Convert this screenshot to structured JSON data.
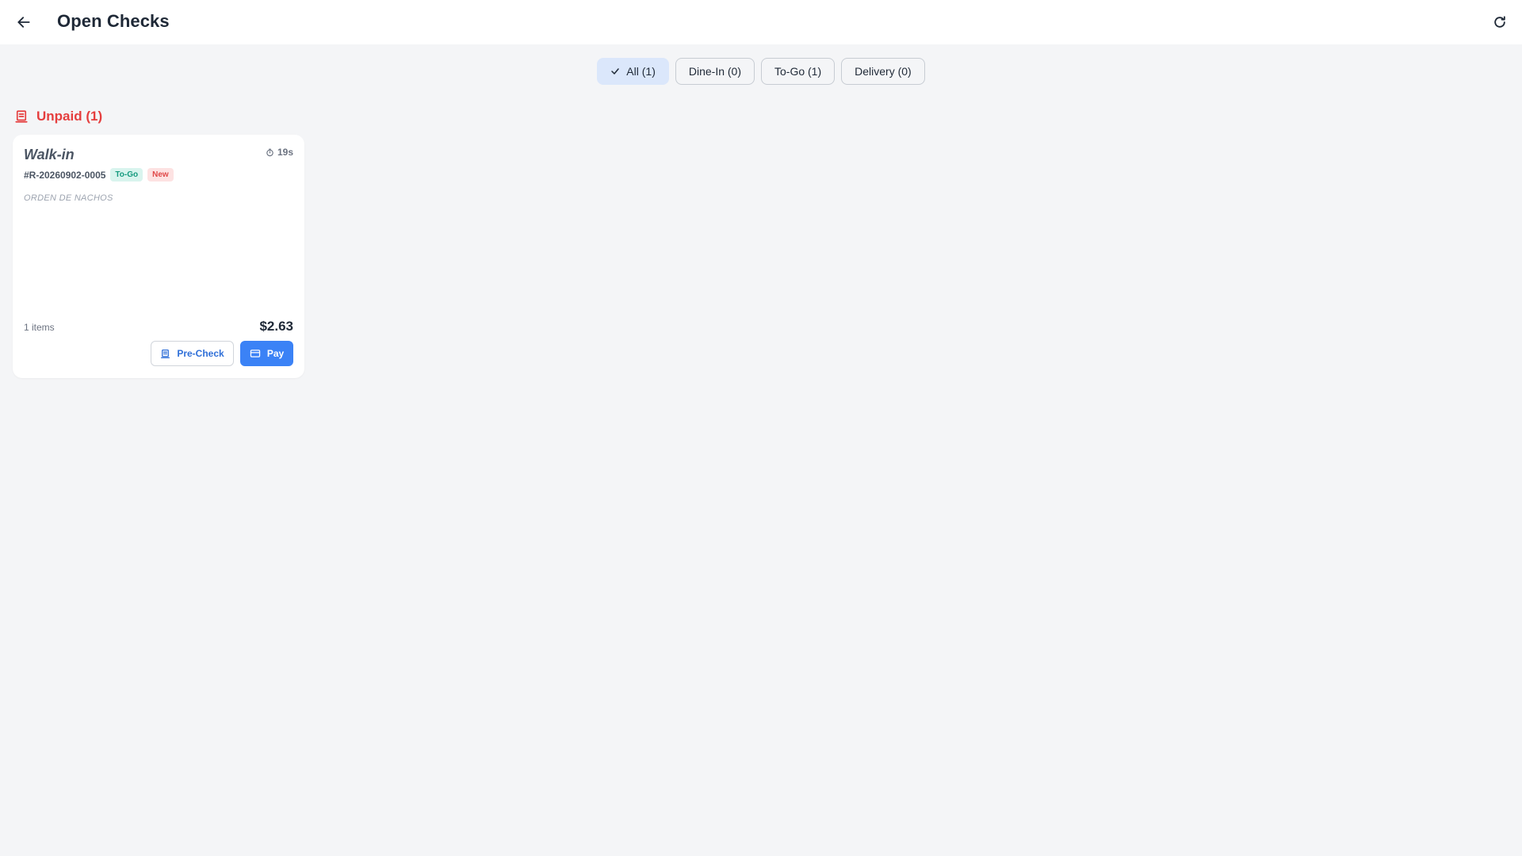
{
  "header": {
    "title": "Open Checks"
  },
  "filters": [
    {
      "label": "All (1)",
      "active": true
    },
    {
      "label": "Dine-In (0)",
      "active": false
    },
    {
      "label": "To-Go (1)",
      "active": false
    },
    {
      "label": "Delivery (0)",
      "active": false
    }
  ],
  "section": {
    "title": "Unpaid (1)",
    "color": "#e53e3e"
  },
  "check": {
    "customer": "Walk-in",
    "elapsed": "19s",
    "number": "#R-20260902-0005",
    "badges": {
      "order_type": "To-Go",
      "status": "New"
    },
    "item_line": "ORDEN DE NACHOS",
    "items_count": "1 items",
    "total": "$2.63",
    "precheck_label": "Pre-Check",
    "pay_label": "Pay"
  },
  "colors": {
    "accent": "#3b82f6",
    "unpaid": "#e53e3e",
    "togo_badge": "#159a7e",
    "new_badge": "#e04848"
  },
  "icons": {
    "back": "arrow-left-icon",
    "refresh": "refresh-icon",
    "active_filter": "check-icon",
    "section": "receipt-icon",
    "timer": "timer-icon",
    "precheck": "receipt-icon",
    "pay": "credit-card-icon"
  }
}
